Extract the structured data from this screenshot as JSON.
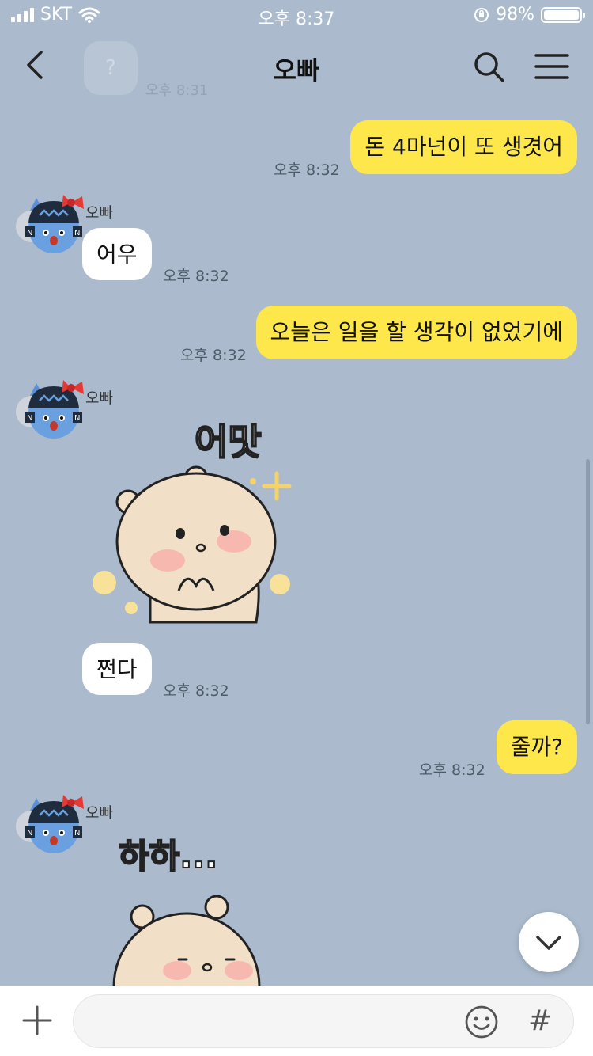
{
  "status_bar": {
    "carrier": "SKT",
    "time": "오후 8:37",
    "battery": "98%"
  },
  "header": {
    "title": "오빠"
  },
  "background_fragment": {
    "bubble": "?",
    "time": "오후 8:31"
  },
  "messages": [
    {
      "from": "me",
      "text": "돈 4마넌이 또 생겻어",
      "time": "오후 8:32"
    },
    {
      "from": "other",
      "sender": "오빠",
      "text": "어우",
      "time": "오후 8:32"
    },
    {
      "from": "me",
      "text": "오늘은 일을 할 생각이 없었기에",
      "time": "오후 8:32"
    },
    {
      "from": "other",
      "sender": "오빠",
      "sticker_text": "어맛",
      "text": "쩐다",
      "time": "오후 8:32"
    },
    {
      "from": "me",
      "text": "줄까?",
      "time": "오후 8:32"
    },
    {
      "from": "other",
      "sender": "오빠",
      "sticker_text": "하하..."
    }
  ],
  "input": {
    "placeholder": "",
    "hash_label": "#"
  },
  "colors": {
    "background": "#abbbcd",
    "my_bubble": "#fde74a",
    "other_bubble": "#ffffff"
  },
  "icons": [
    "back-icon",
    "search-icon",
    "menu-icon",
    "plus-icon",
    "emoji-icon",
    "chevron-down-icon",
    "wifi-icon",
    "signal-icon",
    "battery-icon",
    "orientation-lock-icon"
  ]
}
